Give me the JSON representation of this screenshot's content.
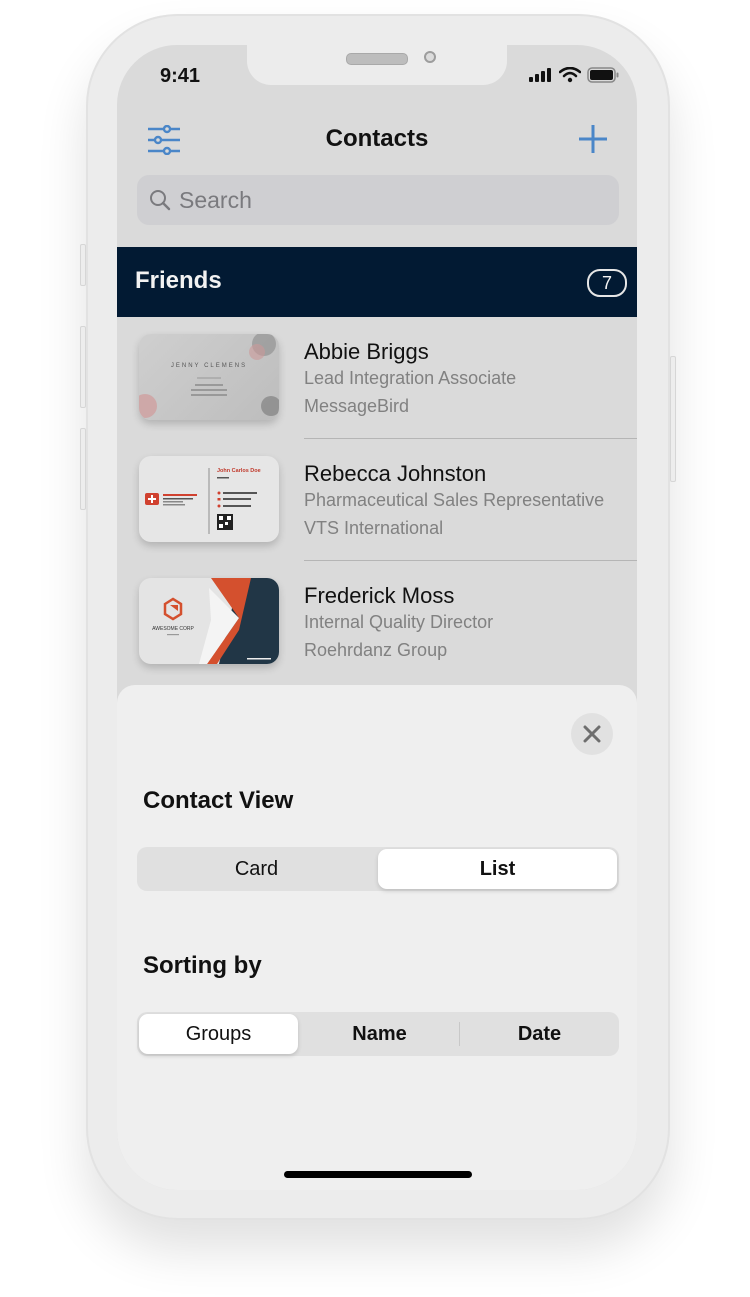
{
  "status_bar": {
    "time": "9:41",
    "icons": [
      "signal-icon",
      "wifi-icon",
      "battery-icon"
    ]
  },
  "nav": {
    "title": "Contacts",
    "left_icon": "filter-sliders-icon",
    "right_icon": "plus-icon"
  },
  "search": {
    "placeholder": "Search"
  },
  "group": {
    "name": "Friends",
    "count": "7"
  },
  "contacts": [
    {
      "name": "Abbie Briggs",
      "title": "Lead Integration Associate",
      "company": "MessageBird",
      "card_text": "JENNY CLEMENS"
    },
    {
      "name": "Rebecca Johnston",
      "title": "Pharmaceutical Sales Representative",
      "company": "VTS International",
      "card_text": "John Carlos Doe"
    },
    {
      "name": "Frederick Moss",
      "title": "Internal Quality Director",
      "company": "Roehrdanz Group",
      "card_text": "AWESOME CORP"
    }
  ],
  "sheet": {
    "contact_view_label": "Contact View",
    "contact_view_options": [
      "Card",
      "List"
    ],
    "contact_view_selected": "List",
    "sorting_label": "Sorting by",
    "sorting_options": [
      "Groups",
      "Name",
      "Date"
    ],
    "sorting_selected": "Groups"
  },
  "colors": {
    "accent": "#4a86c8",
    "section_bg": "#021a33",
    "card_orange": "#d4502e",
    "card_navy": "#213646"
  }
}
